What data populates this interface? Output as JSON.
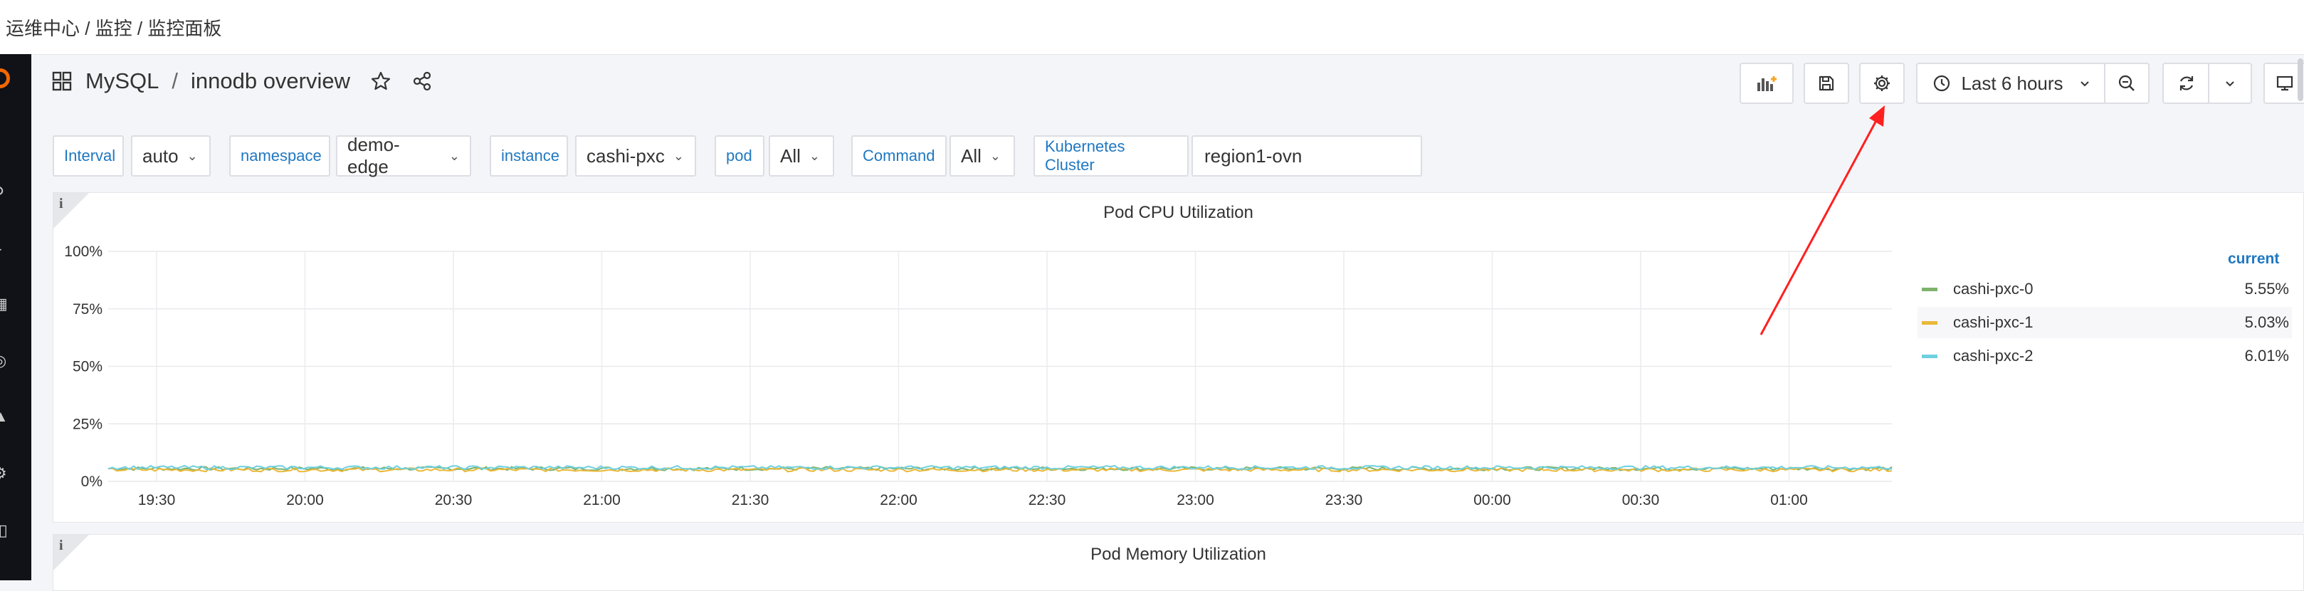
{
  "breadcrumb": "运维中心 / 监控 / 监控面板",
  "dashboard": {
    "folder": "MySQL",
    "separator": "/",
    "name": "innodb overview"
  },
  "toolbar": {
    "time_range": "Last 6 hours"
  },
  "variables": [
    {
      "label": "Interval",
      "value": "auto"
    },
    {
      "label": "namespace",
      "value": "demo-edge"
    },
    {
      "label": "instance",
      "value": "cashi-pxc"
    },
    {
      "label": "pod",
      "value": "All"
    },
    {
      "label": "Command",
      "value": "All"
    },
    {
      "label": "Kubernetes Cluster",
      "value": "region1-ovn"
    }
  ],
  "panels": [
    {
      "title": "Pod CPU Utilization",
      "info": "i"
    },
    {
      "title": "Pod Memory Utilization",
      "info": "i"
    }
  ],
  "chart_data": {
    "type": "line",
    "title": "Pod CPU Utilization",
    "xlabel": "",
    "ylabel": "",
    "y_ticks": [
      "0%",
      "25%",
      "50%",
      "75%",
      "100%"
    ],
    "ylim": [
      0,
      100
    ],
    "x_ticks": [
      "19:30",
      "20:00",
      "20:30",
      "21:00",
      "21:30",
      "22:00",
      "22:30",
      "23:00",
      "23:30",
      "00:00",
      "00:30",
      "01:00"
    ],
    "grid": true,
    "legend_position": "right",
    "legend_header": "current",
    "series": [
      {
        "name": "cashi-pxc-0",
        "current": "5.55%",
        "color": "#7eb26d",
        "base": 5.55
      },
      {
        "name": "cashi-pxc-1",
        "current": "5.03%",
        "color": "#eab839",
        "base": 5.03
      },
      {
        "name": "cashi-pxc-2",
        "current": "6.01%",
        "color": "#6ed0e0",
        "base": 6.01
      }
    ]
  },
  "colors": {
    "accent": "#1f78c1",
    "annotation_arrow": "#ff2020",
    "sidebar": "#111217"
  }
}
